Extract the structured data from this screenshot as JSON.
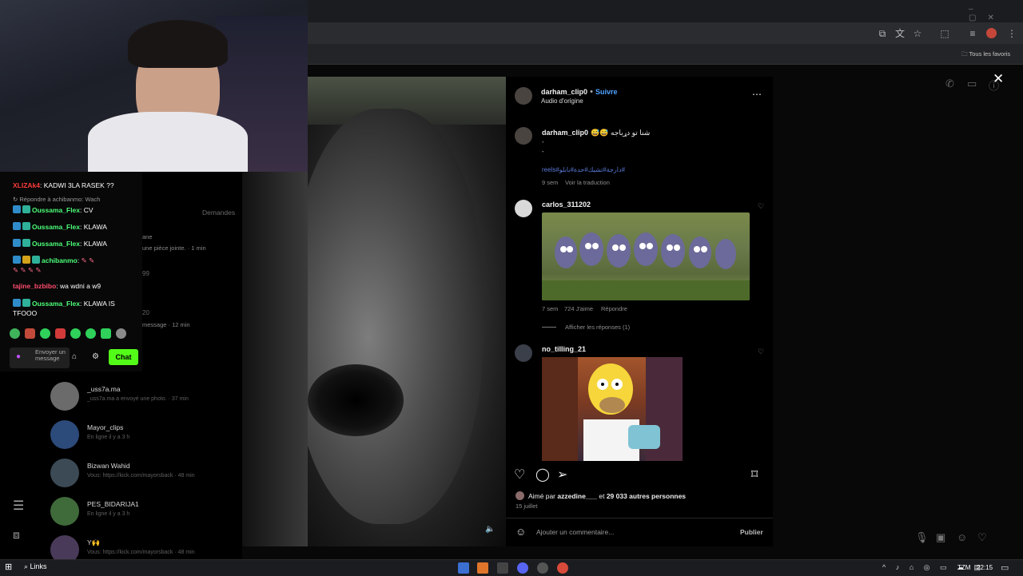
{
  "browser": {
    "bookmarks_bar_label": "Tous les favoris",
    "icons": [
      "install-icon",
      "translate-icon",
      "star-icon",
      "extensions-icon",
      "media-icon",
      "profile-avatar",
      "menu-icon"
    ]
  },
  "stream_chat": {
    "messages": [
      {
        "user": "XLIZAk4",
        "text": ": KADWI 3LA RASEK ??",
        "user_color": "#ff3b3b"
      },
      {
        "reply_prefix": "Répondre à achibanmo: Wach"
      },
      {
        "user": "Oussama_Flex",
        "text": ": CV",
        "user_color": "#4cff7a"
      },
      {
        "user": "Oussama_Flex",
        "text": ": KLAWA",
        "user_color": "#4cff7a"
      },
      {
        "user": "Oussama_Flex",
        "text": ": KLAWA",
        "user_color": "#4cff7a"
      },
      {
        "user": "achibanmo",
        "text": ":",
        "user_color": "#4cff7a"
      },
      {
        "user": "tajine_bzbibo",
        "text": ": wa wdni a w9",
        "user_color": "#ff4d6d"
      },
      {
        "user": "Oussama_Flex",
        "text": ": KLAWA IS",
        "continuation": "TFOOO",
        "user_color": "#4cff7a"
      }
    ],
    "input_placeholder": "Envoyer un message",
    "chat_button": "Chat",
    "accent": "#53fc18"
  },
  "dm_list": {
    "header_fragment": "Demandes",
    "fragments": [
      {
        "text": "ane"
      },
      {
        "text": "une pièce jointe. · 1 min"
      },
      {
        "text": "99"
      },
      {
        "text": "20"
      },
      {
        "text": "message · 12 min"
      }
    ],
    "rows": [
      {
        "name": "_uss7a.ma",
        "sub": "_uss7a.ma a envoyé une photo. · 37 min"
      },
      {
        "name": "Mayor_clips",
        "sub": "En ligne il y a 3 h"
      },
      {
        "name": "Bizwan Wahid",
        "sub": "Vous: https://kick.com/mayorsback · 48 min"
      },
      {
        "name": "PES_BIDARIJA1",
        "sub": "En ligne il y a 3 h"
      },
      {
        "name": "Y🙌",
        "sub": "Vous: https://kick.com/mayorsback · 48 min"
      }
    ]
  },
  "post": {
    "author": "darham_clip0",
    "follow": "Suivre",
    "audio": "Audio d'origine",
    "caption_user": "darham_clip0",
    "caption_text": "😅😅 شنا تو دړباجه",
    "caption_dash1": "-",
    "caption_dash2": "-",
    "hashtags": "reels#دارجة#تشيك#حدة#بابلو#",
    "caption_age": "9 sem",
    "see_translation": "Voir la traduction",
    "comments": [
      {
        "user": "carlos_311202",
        "age": "7 sem",
        "likes": "724 J'aime",
        "reply": "Répondre",
        "view_replies": "Afficher les réponses (1)"
      },
      {
        "user": "no_tilling_21"
      }
    ],
    "liked_by_prefix": "Aimé par ",
    "liked_by_user": "azzedine___",
    "liked_by_and": " et ",
    "liked_by_count": "29 033 autres personnes",
    "date": "15 juillet",
    "comment_placeholder": "Ajouter un commentaire...",
    "publish": "Publier"
  },
  "taskbar": {
    "search_label": "Links",
    "tray": {
      "lang": "TZM",
      "time": "22:15"
    }
  }
}
